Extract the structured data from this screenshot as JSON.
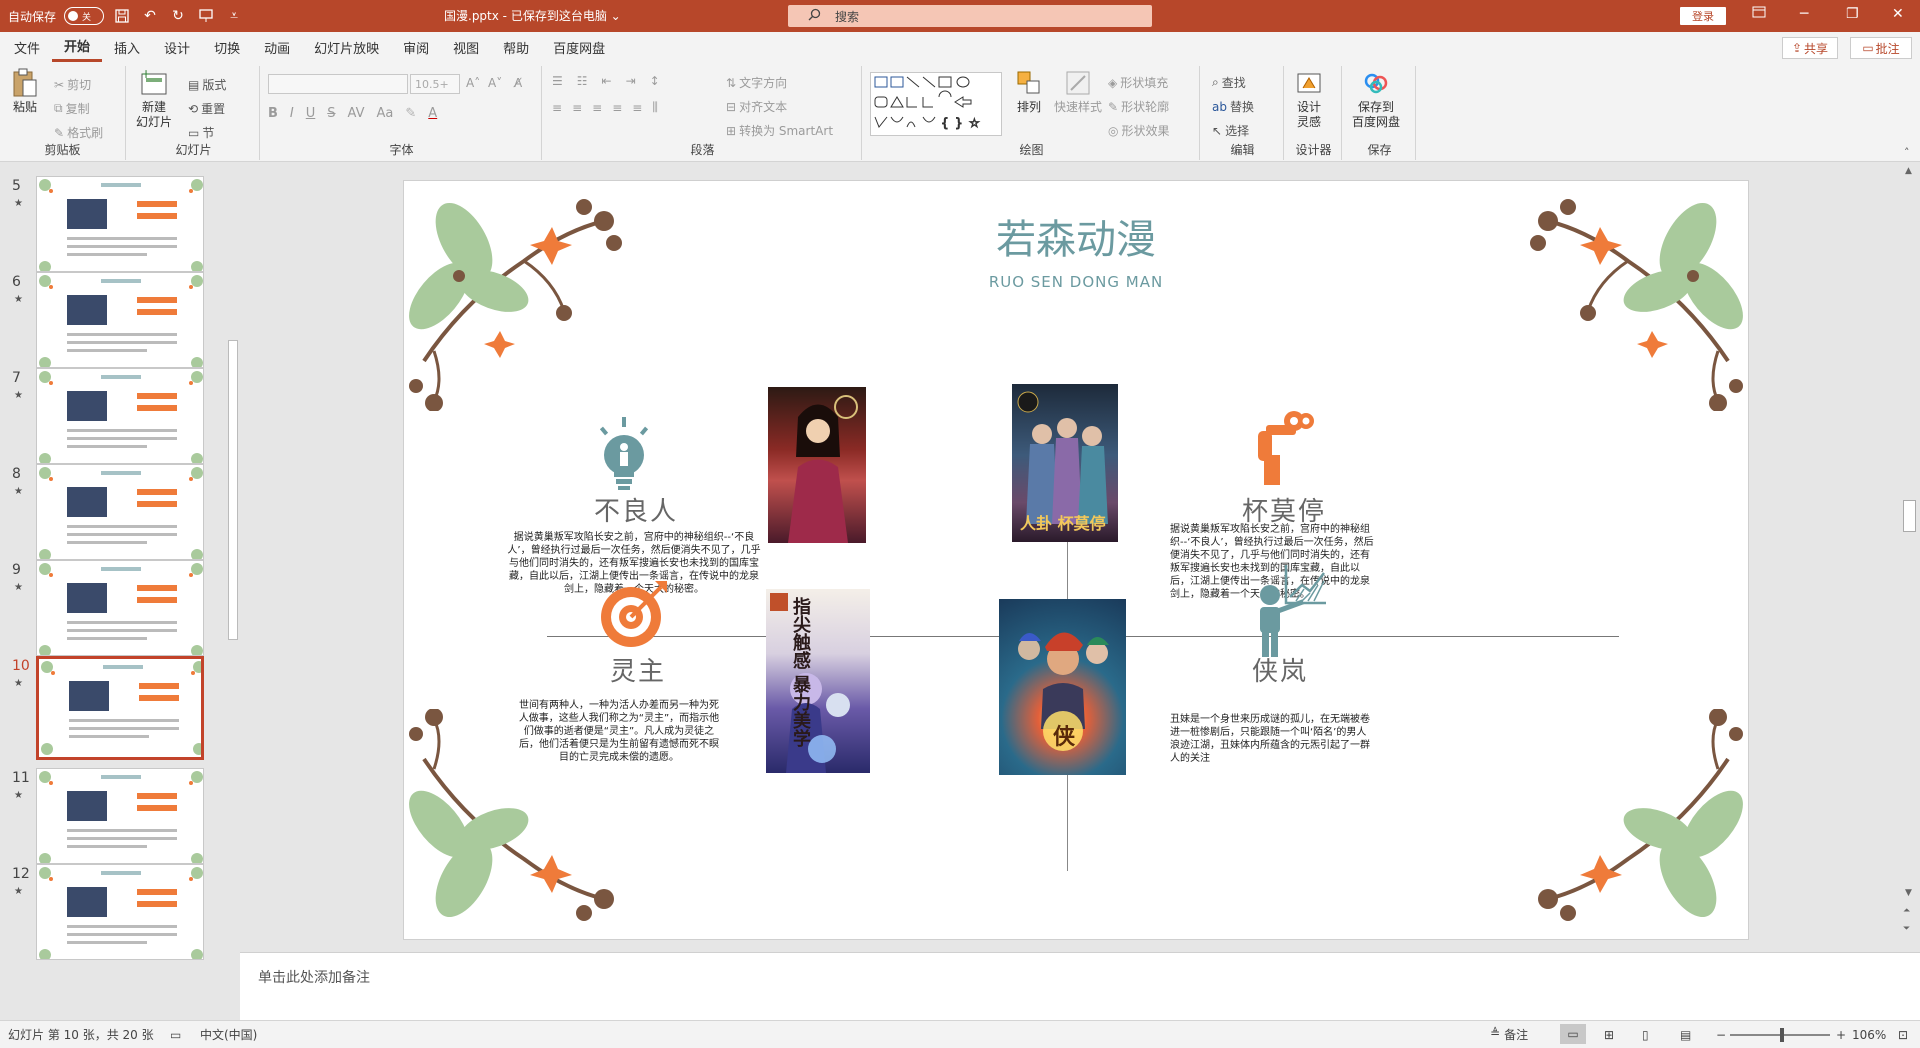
{
  "titlebar": {
    "autosave_label": "自动保存",
    "autosave_state": "关",
    "doc_title": "国漫.pptx - 已保存到这台电脑 ⌄",
    "search_placeholder": "搜索",
    "login_label": "登录"
  },
  "menu": {
    "tabs": [
      "文件",
      "开始",
      "插入",
      "设计",
      "切换",
      "动画",
      "幻灯片放映",
      "审阅",
      "视图",
      "帮助",
      "百度网盘"
    ],
    "active": "开始",
    "share_label": "共享",
    "comment_label": "批注"
  },
  "ribbon": {
    "clipboard": {
      "label": "剪贴板",
      "paste": "粘贴",
      "cut": "剪切",
      "copy": "复制",
      "format_painter": "格式刷"
    },
    "slides": {
      "label": "幻灯片",
      "new_slide": "新建\n幻灯片",
      "layout": "版式",
      "reset": "重置",
      "section": "节"
    },
    "font": {
      "label": "字体",
      "size": "10.5+"
    },
    "paragraph": {
      "label": "段落",
      "text_direction": "文字方向",
      "align_text": "对齐文本",
      "smartart": "转换为 SmartArt"
    },
    "drawing": {
      "label": "绘图",
      "arrange": "排列",
      "quick_styles": "快速样式",
      "shape_fill": "形状填充",
      "shape_outline": "形状轮廓",
      "shape_effects": "形状效果"
    },
    "editing": {
      "label": "编辑",
      "find": "查找",
      "replace": "替换",
      "select": "选择"
    },
    "designer": {
      "label": "设计器",
      "design_ideas": "设计\n灵感"
    },
    "save": {
      "label": "保存",
      "save_baidu": "保存到\n百度网盘"
    }
  },
  "thumbnails": [
    {
      "num": "5"
    },
    {
      "num": "6"
    },
    {
      "num": "7"
    },
    {
      "num": "8"
    },
    {
      "num": "9"
    },
    {
      "num": "10",
      "active": true
    },
    {
      "num": "11"
    },
    {
      "num": "12"
    }
  ],
  "slide": {
    "title": "若森动漫",
    "subtitle": "RUO SEN DONG MAN",
    "items": [
      {
        "name": "不良人",
        "desc": "据说黄巢叛军攻陷长安之前，宫府中的神秘组织--‘不良人’，曾经执行过最后一次任务，然后便消失不见了，几乎与他们同时消失的，还有叛军搜遍长安也未找到的国库宝藏，自此以后，江湖上便传出一条谣言，在传说中的龙泉剑上，隐藏着一个天大的秘密。"
      },
      {
        "name": "杯莫停",
        "desc": "据说黄巢叛军攻陷长安之前，宫府中的神秘组织--‘不良人’，曾经执行过最后一次任务，然后便消失不见了，几乎与他们同时消失的，还有叛军搜遍长安也未找到的国库宝藏，自此以后，江湖上便传出一条谣言，在传说中的龙泉剑上，隐藏着一个天大的秘密。"
      },
      {
        "name": "灵主",
        "desc": "世间有两种人，一种为活人办差而另一种为死人做事，这些人我们称之为“灵主”，而指示他们做事的逝者便是“灵主”。凡人成为灵徒之后，他们活着便只是为生前留有遗憾而死不瞑目的亡灵完成未偿的遗愿。",
        "highlight": "灵主"
      },
      {
        "name": "侠岚",
        "desc": "丑妹是一个身世来历成谜的孤儿，在无端被卷进一桩惨剧后，只能跟随一个叫‘陌名’的男人浪迹江湖，丑妹体内所蕴含的元炁引起了一群人的关注"
      }
    ],
    "posters": [
      {
        "name": "poster-buliangren",
        "chars": ""
      },
      {
        "name": "poster-beimoting",
        "chars": "人卦 杯莫停"
      },
      {
        "name": "poster-lingzhu",
        "chars": "指尖触感 暴力美学"
      },
      {
        "name": "poster-xialan",
        "chars": "侠"
      }
    ]
  },
  "notes_placeholder": "单击此处添加备注",
  "status": {
    "slide_info": "幻灯片 第 10 张，共 20 张",
    "language": "中文(中国)",
    "notes_btn": "备注",
    "zoom": "106%"
  }
}
